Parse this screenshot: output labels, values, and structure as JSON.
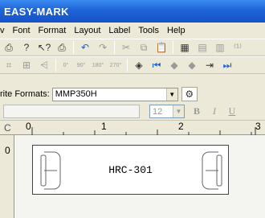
{
  "app": {
    "title": "EASY-MARK"
  },
  "menu": {
    "items": [
      "Font",
      "Format",
      "Layout",
      "Label",
      "Tools",
      "Help"
    ],
    "partial_first": "v"
  },
  "toolbar_zoom": {
    "labels": [
      "0°",
      "90°",
      "180°",
      "270°"
    ]
  },
  "write_formats": {
    "label": "rite Formats:",
    "value": "MMP350H"
  },
  "font": {
    "size": "12",
    "bold": "B",
    "italic": "I",
    "underline": "U"
  },
  "ruler": {
    "corner": "C",
    "marks": [
      "0",
      "1",
      "2",
      "3"
    ]
  },
  "vruler": {
    "mark": "0"
  },
  "label": {
    "text": "HRC-301"
  }
}
